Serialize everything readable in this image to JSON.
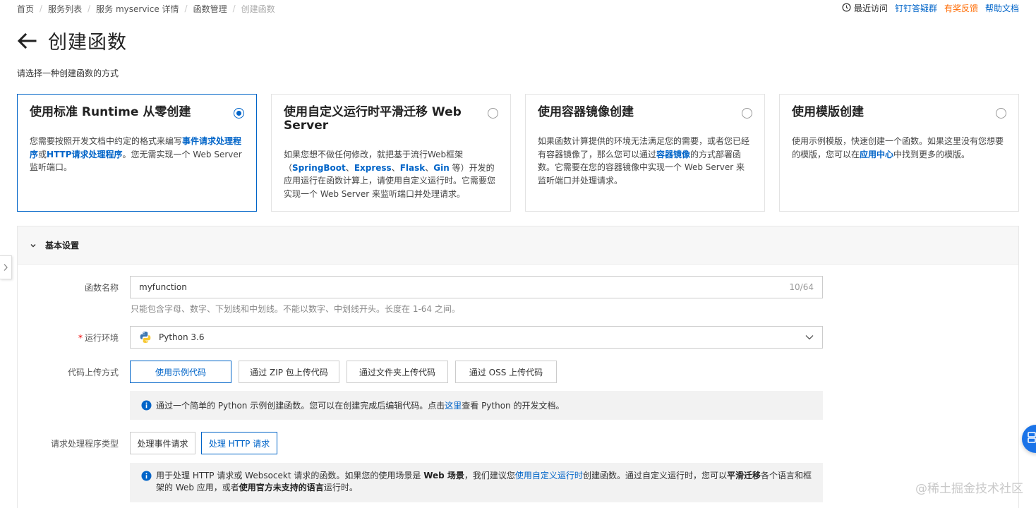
{
  "breadcrumb": {
    "items": [
      "首页",
      "服务列表",
      "服务 myservice 详情",
      "函数管理",
      "创建函数"
    ],
    "separator": "/"
  },
  "top_links": {
    "recent": "最近访问",
    "dingtalk": "钉钉答疑群",
    "feedback": "有奖反馈",
    "help": "帮助文档"
  },
  "header": {
    "title": "创建函数",
    "subtitle": "请选择一种创建函数的方式"
  },
  "cards": [
    {
      "title": "使用标准 Runtime 从零创建",
      "selected": true,
      "desc_parts": [
        "您需要按照开发文档中约定的格式来编写",
        "事件请求处理程序",
        "或",
        "HTTP请求处理程序",
        "。您无需实现一个 Web Server 监听端口。"
      ]
    },
    {
      "title": "使用自定义运行时平滑迁移 Web Server",
      "selected": false,
      "desc_parts": [
        "如果您想不做任何修改，就把基于流行Web框架（",
        "SpringBoot",
        "、",
        "Express",
        "、",
        "Flask",
        "、",
        "Gin",
        " 等）开发的应用运行在函数计算上，请使用自定义运行时。它需要您实现一个 Web Server 来监听端口并处理请求。"
      ]
    },
    {
      "title": "使用容器镜像创建",
      "selected": false,
      "desc_parts": [
        "如果函数计算提供的环境无法满足您的需要，或者您已经有容器镜像了，那么您可以通过",
        "容器镜像",
        "的方式部署函数。它需要在您的容器镜像中实现一个 Web Server 来监听端口并处理请求。"
      ]
    },
    {
      "title": "使用模版创建",
      "selected": false,
      "desc_parts": [
        "使用示例模版，快速创建一个函数。如果这里没有您想要的模版，您可以在",
        "应用中心",
        "中找到更多的模版。"
      ]
    }
  ],
  "panel": {
    "title": "基本设置"
  },
  "form": {
    "function_name": {
      "label": "函数名称",
      "value": "myfunction",
      "count": "10/64",
      "help": "只能包含字母、数字、下划线和中划线。不能以数字、中划线开头。长度在 1-64 之间。"
    },
    "runtime": {
      "required_mark": "*",
      "label": "运行环境",
      "value": "Python 3.6"
    },
    "upload": {
      "label": "代码上传方式",
      "options": [
        "使用示例代码",
        "通过 ZIP 包上传代码",
        "通过文件夹上传代码",
        "通过 OSS 上传代码"
      ],
      "selected_index": 0,
      "info_before": "通过一个简单的 Python 示例创建函数。您可以在创建完成后编辑代码。点击",
      "info_link": "这里",
      "info_after": "查看 Python 的开发文档。"
    },
    "handler_type": {
      "label": "请求处理程序类型",
      "options": [
        "处理事件请求",
        "处理 HTTP 请求"
      ],
      "selected_index": 1,
      "info_1": "用于处理 HTTP 请求或 Websocekt 请求的函数。如果您的使用场景是 ",
      "info_bold_1": "Web 场景",
      "info_2": "，我们建议您",
      "info_link": "使用自定义运行时",
      "info_3": "创建函数。通过自定义运行时，您可以",
      "info_bold_2": "平滑迁移",
      "info_4": "各个语言和框架的 Web 应用，或者",
      "info_bold_3": "使用官方未支持的语言",
      "info_5": "运行时。"
    }
  },
  "watermark": "@稀土掘金技术社区",
  "colors": {
    "primary": "#0064c8",
    "orange": "#ff6a00",
    "fab": "#1a73e8"
  },
  "icons": [
    "clock-icon",
    "back-arrow-icon",
    "radio-icon",
    "chevron-down-icon",
    "chevron-right-icon",
    "python-icon",
    "info-icon"
  ]
}
